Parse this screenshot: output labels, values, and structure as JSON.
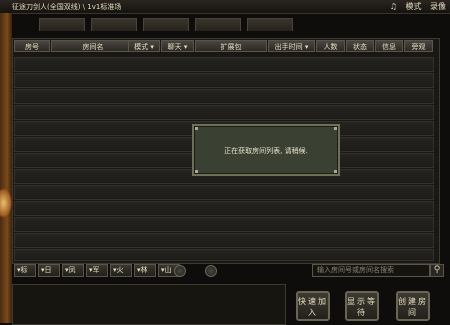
{
  "window": {
    "title": "征途刀剑人(全国双线) \\ 1v1标准场",
    "music_icon": "music-note-icon",
    "mode_label": "模式",
    "record_label": "录像"
  },
  "tabs": [
    "",
    "",
    "",
    "",
    ""
  ],
  "table": {
    "columns": [
      "房号",
      "房间名",
      "模式 ▾",
      "聊天 ▾",
      "扩展包",
      "出手时间 ▾",
      "人数",
      "状态",
      "信息",
      "旁观"
    ],
    "rows": [
      [],
      [],
      [],
      [],
      [],
      [],
      [],
      [],
      [],
      [],
      [],
      [],
      []
    ]
  },
  "modal": {
    "message": "正在获取房间列表, 请稍候."
  },
  "filters": {
    "options": [
      "标",
      "日",
      "凤",
      "军",
      "火",
      "林",
      "山"
    ],
    "search_placeholder": "输入房间号或房间名搜索"
  },
  "buttons": {
    "quick_join": "快速加入",
    "show_waiting": "显示等待",
    "create_room": "创建房间"
  }
}
